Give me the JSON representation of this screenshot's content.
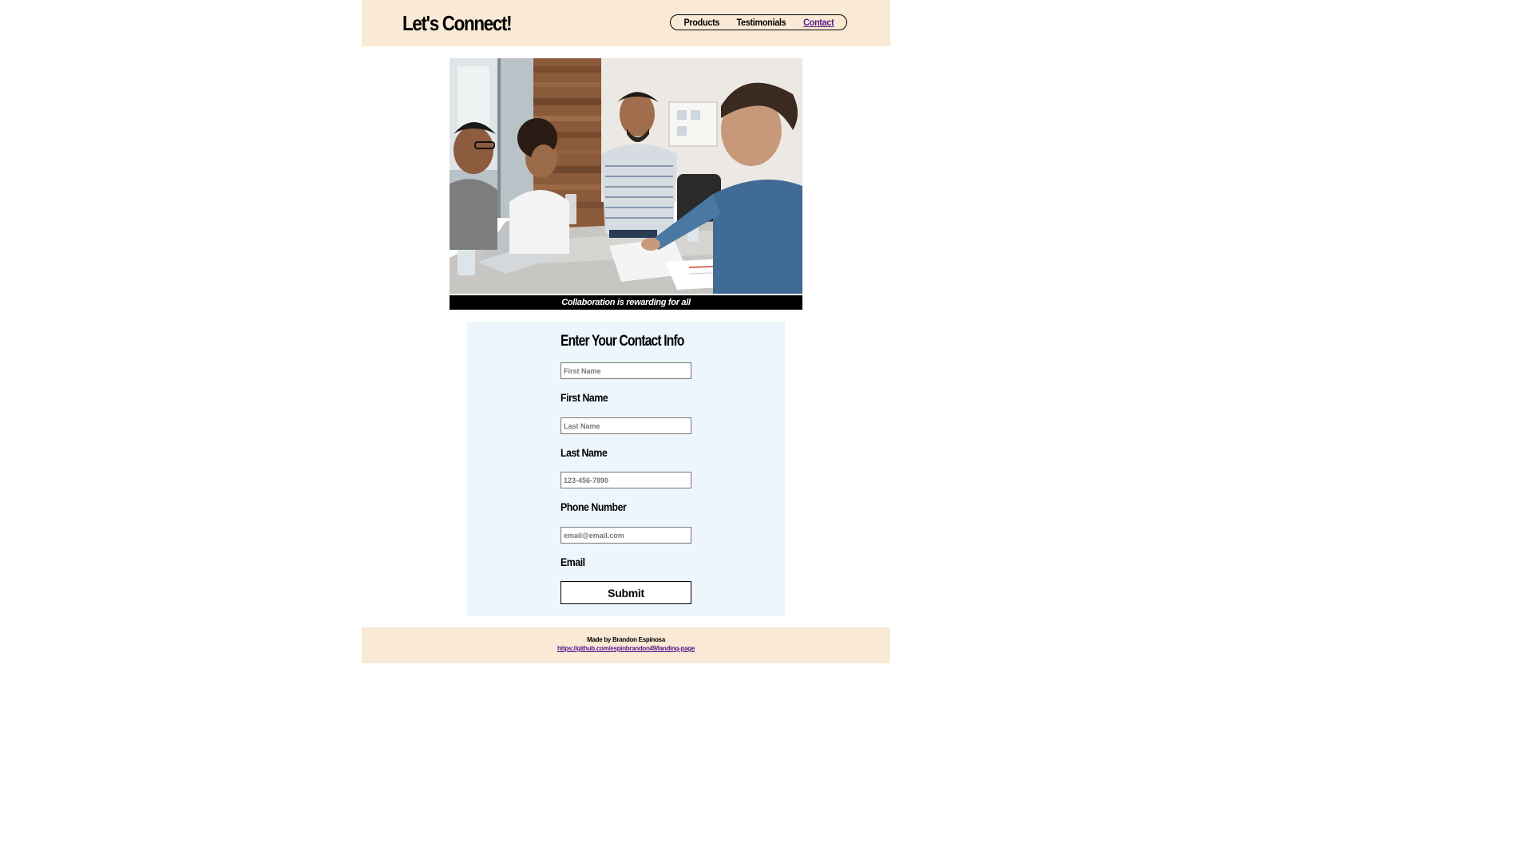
{
  "header": {
    "brand": "Let's Connect!",
    "nav": [
      {
        "label": "Products"
      },
      {
        "label": "Testimonials"
      },
      {
        "label": "Contact"
      }
    ]
  },
  "hero": {
    "caption": "Collaboration is rewarding for all"
  },
  "form": {
    "title": "Enter Your Contact Info",
    "fields": [
      {
        "placeholder": "First Name",
        "label": "First Name",
        "value": ""
      },
      {
        "placeholder": "Last Name",
        "label": "Last Name",
        "value": ""
      },
      {
        "placeholder": "123-456-7890",
        "label": "Phone Number",
        "value": ""
      },
      {
        "placeholder": "email@email.com",
        "label": "Email",
        "value": ""
      }
    ],
    "submit_label": "Submit"
  },
  "footer": {
    "credit": "Made by Brandon Espinosa",
    "link": "https://github.com/espinbrandon49/landing-page"
  },
  "colors": {
    "header_bg": "#f9e9d5",
    "panel_bg": "#eef6fd",
    "link_visited": "#551a8b"
  }
}
